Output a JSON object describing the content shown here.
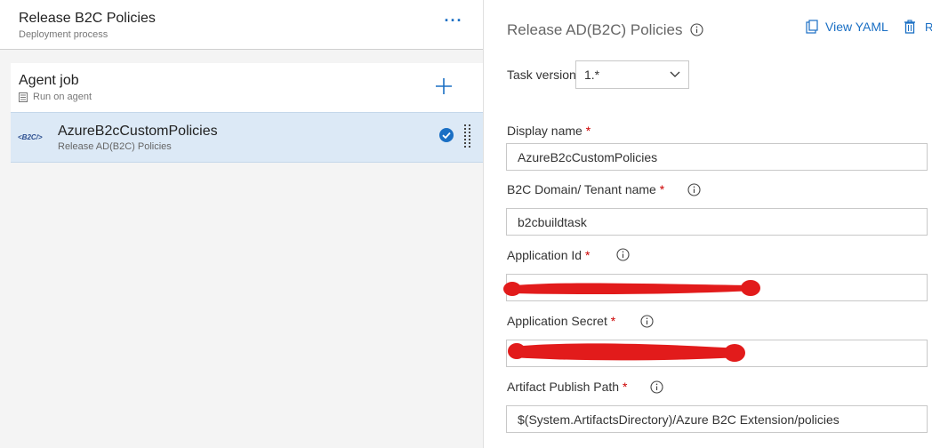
{
  "pipeline": {
    "title": "Release B2C Policies",
    "subtitle": "Deployment process",
    "more": "···"
  },
  "agent_job": {
    "title": "Agent job",
    "subtitle": "Run on agent"
  },
  "task": {
    "icon_text": "<B2C/>",
    "title": "AzureB2cCustomPolicies",
    "subtitle": "Release AD(B2C) Policies"
  },
  "panel": {
    "title": "Release AD(B2C) Policies",
    "view_yaml": "View YAML",
    "cut_label": "R",
    "task_version_label": "Task version",
    "task_version_value": "1.*",
    "fields": {
      "display_name": {
        "label": "Display name",
        "value": "AzureB2cCustomPolicies"
      },
      "tenant": {
        "label": "B2C Domain/ Tenant name",
        "value": "b2cbuildtask"
      },
      "app_id": {
        "label": "Application Id",
        "value": ""
      },
      "app_secret": {
        "label": "Application Secret",
        "value": ""
      },
      "artifact_path": {
        "label": "Artifact Publish Path",
        "value": "$(System.ArtifactsDirectory)/Azure B2C Extension/policies"
      }
    },
    "required_mark": "*"
  },
  "colors": {
    "accent": "#1a6fc4",
    "selected_row": "#dce9f6",
    "required": "#cc0000",
    "redaction": "#e21b1b"
  }
}
